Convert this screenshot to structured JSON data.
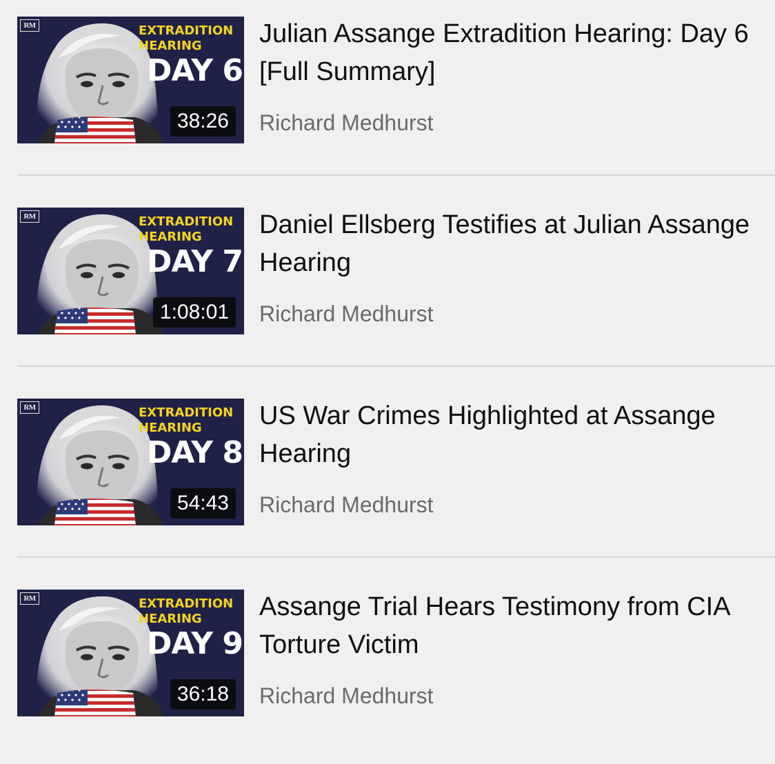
{
  "videos": [
    {
      "title": "Julian Assange Extradition Hearing: Day 6 [Full Summary]",
      "channel": "Richard Medhurst",
      "duration": "38:26",
      "thumb_logo": "RM",
      "thumb_label": "EXTRADITION\nHEARING",
      "thumb_day": "DAY 6"
    },
    {
      "title": "Daniel Ellsberg Testifies at Julian Assange Hearing",
      "channel": "Richard Medhurst",
      "duration": "1:08:01",
      "thumb_logo": "RM",
      "thumb_label": "EXTRADITION\nHEARING",
      "thumb_day": "DAY 7"
    },
    {
      "title": "US War Crimes Highlighted at Assange Hearing",
      "channel": "Richard Medhurst",
      "duration": "54:43",
      "thumb_logo": "RM",
      "thumb_label": "EXTRADITION\nHEARING",
      "thumb_day": "DAY 8"
    },
    {
      "title": "Assange Trial Hears Testimony from CIA Torture Victim",
      "channel": "Richard Medhurst",
      "duration": "36:18",
      "thumb_logo": "RM",
      "thumb_label": "EXTRADITION\nHEARING",
      "thumb_day": "DAY 9"
    }
  ],
  "colors": {
    "background": "#f0f0f0",
    "thumb_background": "#1f2147",
    "label_yellow": "#f5d41f",
    "title_text": "#0f0f0f",
    "channel_text": "#6a6a6a"
  }
}
